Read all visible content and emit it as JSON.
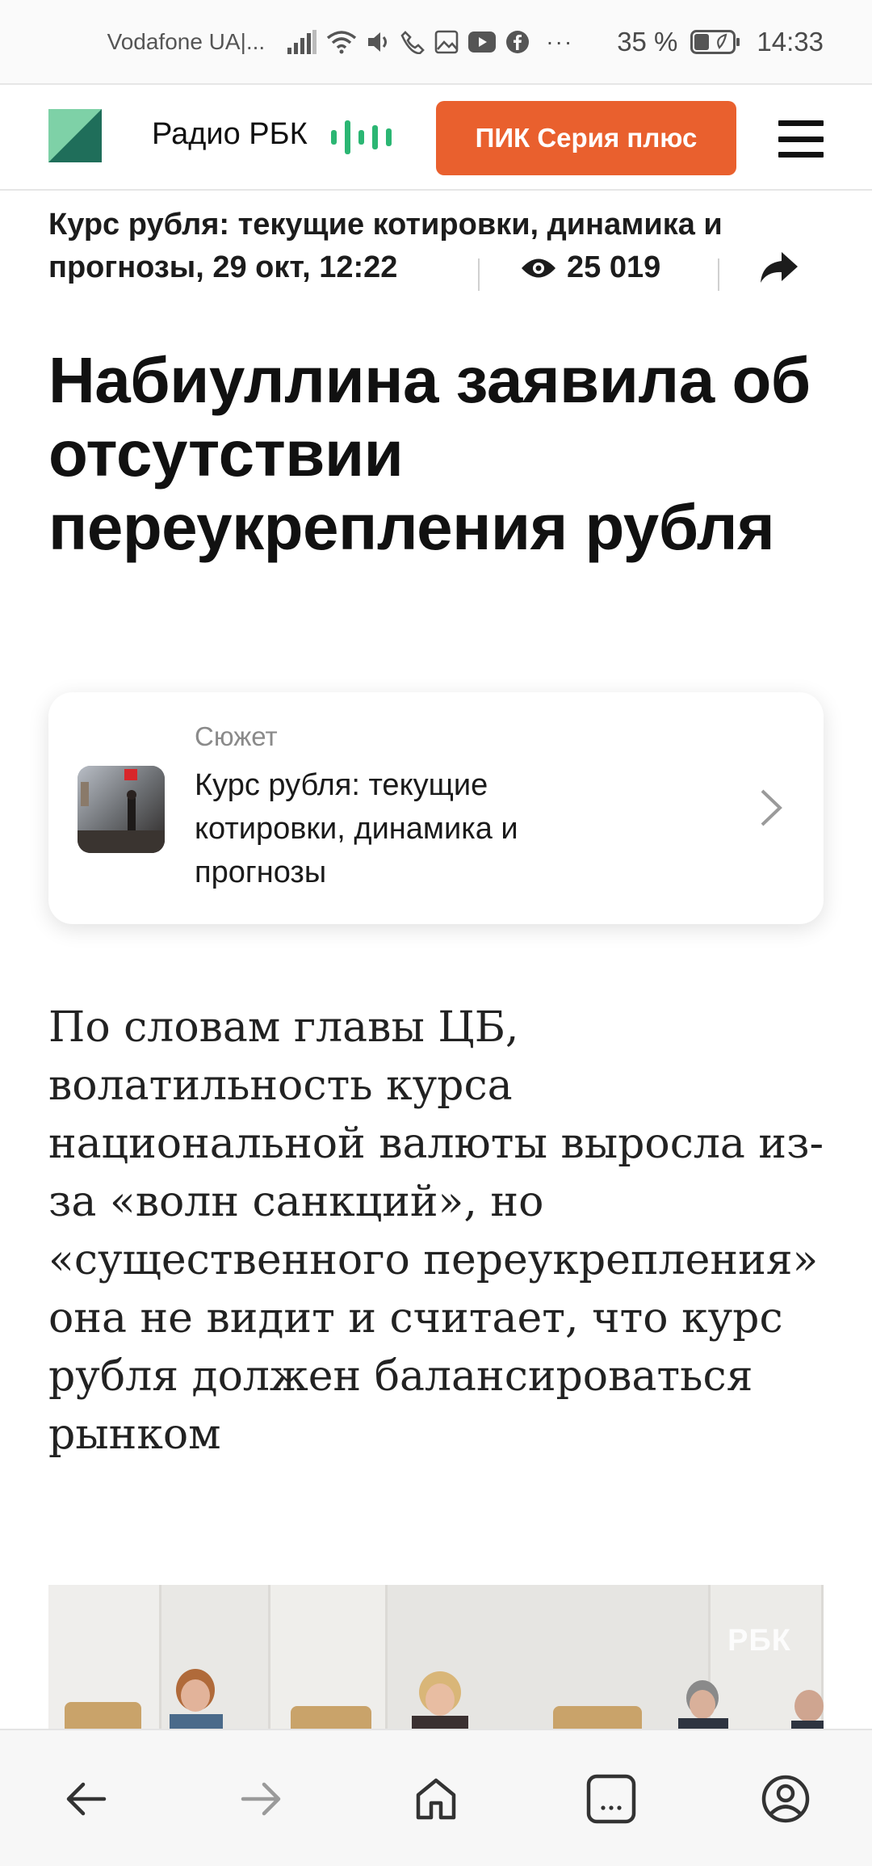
{
  "status_bar": {
    "carrier": "Vodafone UA|...",
    "more": "···",
    "battery": "35 %",
    "time": "14:33",
    "icons": [
      "signal-icon",
      "wifi-icon",
      "volume-icon",
      "call-icon",
      "gallery-icon",
      "youtube-icon",
      "facebook-icon",
      "battery-icon"
    ]
  },
  "header": {
    "radio_label": "Радио РБК",
    "promo_button": "ПИК Серия плюс",
    "colors": {
      "promo": "#e9602e",
      "radio_bars": "#2bb673",
      "logo_green": "#1f6e5a"
    }
  },
  "story_line": {
    "title": "Курс рубля: текущие котировки, динамика и",
    "date": "прогнозы, 29 окт, 12:22",
    "views": "25 019"
  },
  "headline": "Набиуллина заявила об отсутствии переукрепления рубля",
  "story_card": {
    "kicker": "Сюжет",
    "title": "Курс рубля: текущие котировки, динамика и прогнозы"
  },
  "lead": "По словам главы ЦБ, волатильность курса национальной валюты выросла из-за «волн санкций», но «существенного переукрепления» она не видит и считает, что курс рубля должен балансироваться рынком",
  "photo": {
    "watermark": "РБК"
  },
  "bottom_nav": {
    "items": [
      "back-icon",
      "forward-icon",
      "home-icon",
      "tabs-icon",
      "account-icon"
    ]
  }
}
